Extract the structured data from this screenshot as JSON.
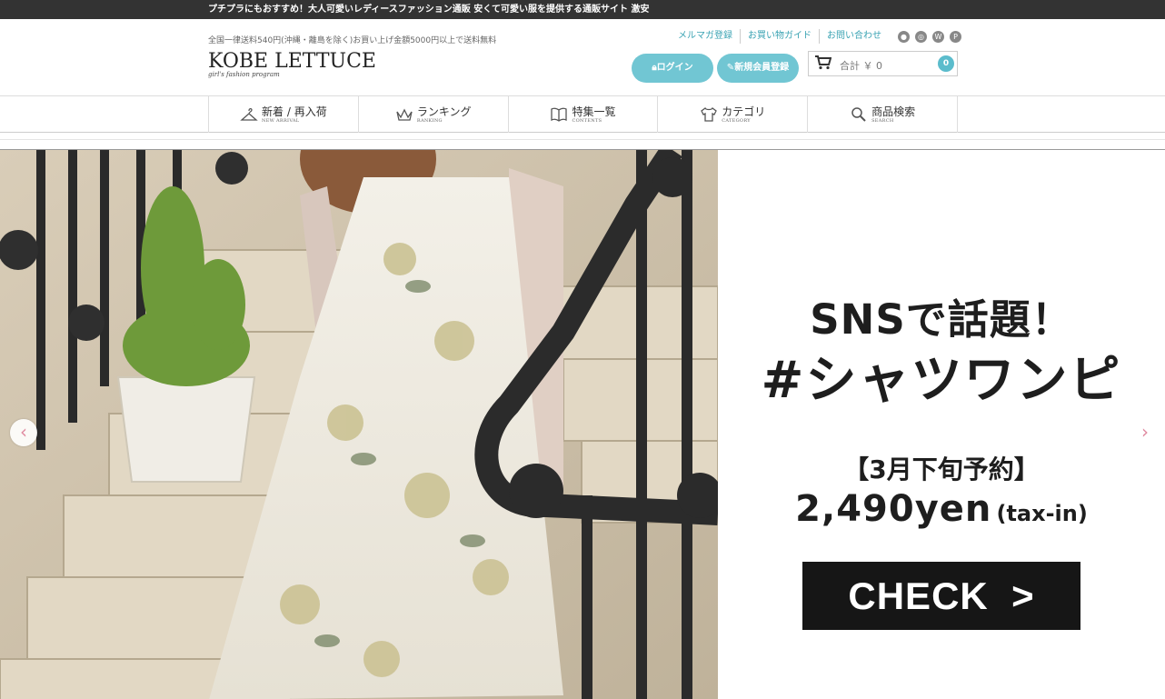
{
  "topbar": {
    "text": "プチプラにもおすすめ！大人可愛いレディースファッション通販 安くて可愛い服を提供する通販サイト 激安"
  },
  "header": {
    "shipping_note": "全国一律送料540円(沖縄・離島を除く)お買い上げ金額5000円以上で送料無料",
    "logo_text": "KOBE LETTUCE",
    "logo_tagline": "girl's fashion program",
    "links": [
      "メルマガ登録",
      "お買い物ガイド",
      "お問い合わせ"
    ],
    "social_icons": [
      "line-icon",
      "instagram-icon",
      "wear-icon",
      "pinterest-icon"
    ],
    "login_label": "ログイン",
    "register_label": "新規会員登録",
    "cart_label": "合計 ￥ 0",
    "cart_count": "0"
  },
  "nav": {
    "items": [
      {
        "label": "新着 / 再入荷",
        "sub": "NEW ARRIVAL",
        "icon": "hanger-icon"
      },
      {
        "label": "ランキング",
        "sub": "RANKING",
        "icon": "crown-icon"
      },
      {
        "label": "特集一覧",
        "sub": "CONTENTS",
        "icon": "book-icon"
      },
      {
        "label": "カテゴリ",
        "sub": "CATEGORY",
        "icon": "shirt-icon"
      },
      {
        "label": "商品検索",
        "sub": "SEARCH",
        "icon": "search-icon"
      }
    ]
  },
  "hero": {
    "headline1": "SNSで話題！",
    "headline2": "#シャツワンピ",
    "reservation": "【3月下旬予約】",
    "price": "2,490yen",
    "tax": "(tax-in)",
    "cta": "CHECK",
    "prev_arrow": "‹",
    "next_arrow": "›"
  },
  "colors": {
    "accent": "#71c6d3",
    "topbar": "#333333",
    "link": "#3aa3b3",
    "arrow": "#e08aa0"
  }
}
